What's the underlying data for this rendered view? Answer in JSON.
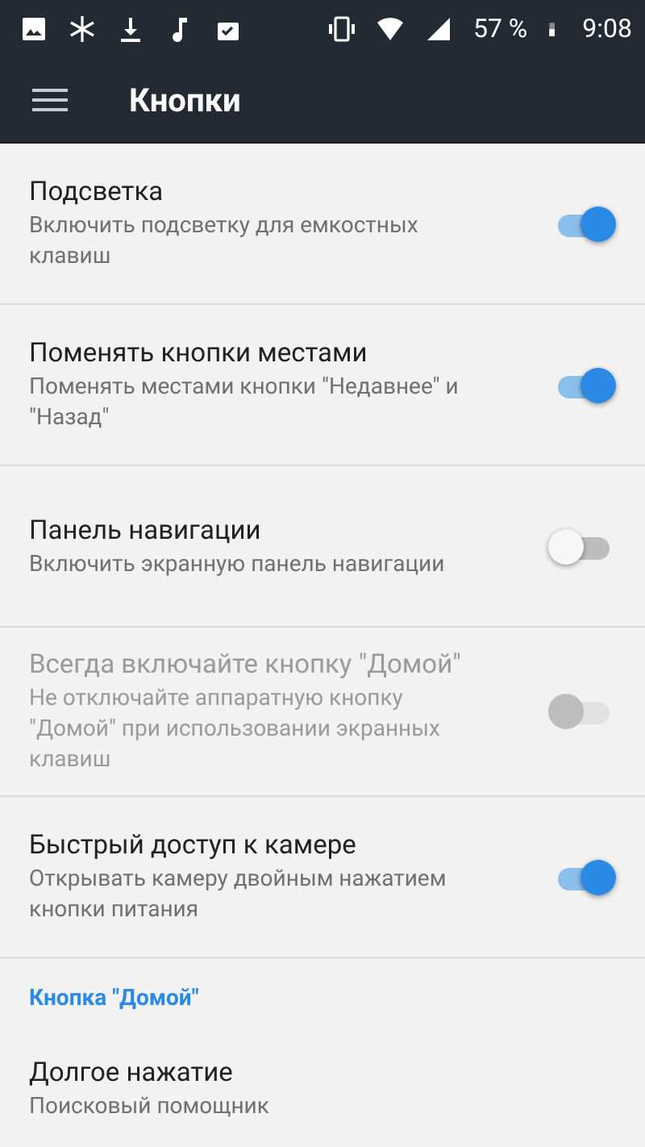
{
  "status_bar": {
    "battery": "57 %",
    "time": "9:08"
  },
  "toolbar": {
    "title": "Кнопки"
  },
  "settings": [
    {
      "kind": "switch",
      "title": "Подсветка",
      "summary": "Включить подсветку для емкостных клавиш",
      "on": true,
      "disabled": false
    },
    {
      "kind": "switch",
      "title": "Поменять кнопки местами",
      "summary": "Поменять местами кнопки \"Недавнее\" и \"Назад\"",
      "on": true,
      "disabled": false
    },
    {
      "kind": "switch",
      "title": "Панель навигации",
      "summary": "Включить экранную панель навигации",
      "on": false,
      "disabled": false
    },
    {
      "kind": "switch",
      "title": "Всегда включайте кнопку \"Домой\"",
      "summary": "Не отключайте аппаратную кнопку \"Домой\" при использовании экранных клавиш",
      "on": false,
      "disabled": true
    },
    {
      "kind": "switch",
      "title": "Быстрый доступ к камере",
      "summary": "Открывать камеру двойным нажатием кнопки питания",
      "on": true,
      "disabled": false
    },
    {
      "kind": "header",
      "title": "Кнопка \"Домой\""
    },
    {
      "kind": "plain",
      "title": "Долгое нажатие",
      "summary": "Поисковый помощник"
    }
  ]
}
